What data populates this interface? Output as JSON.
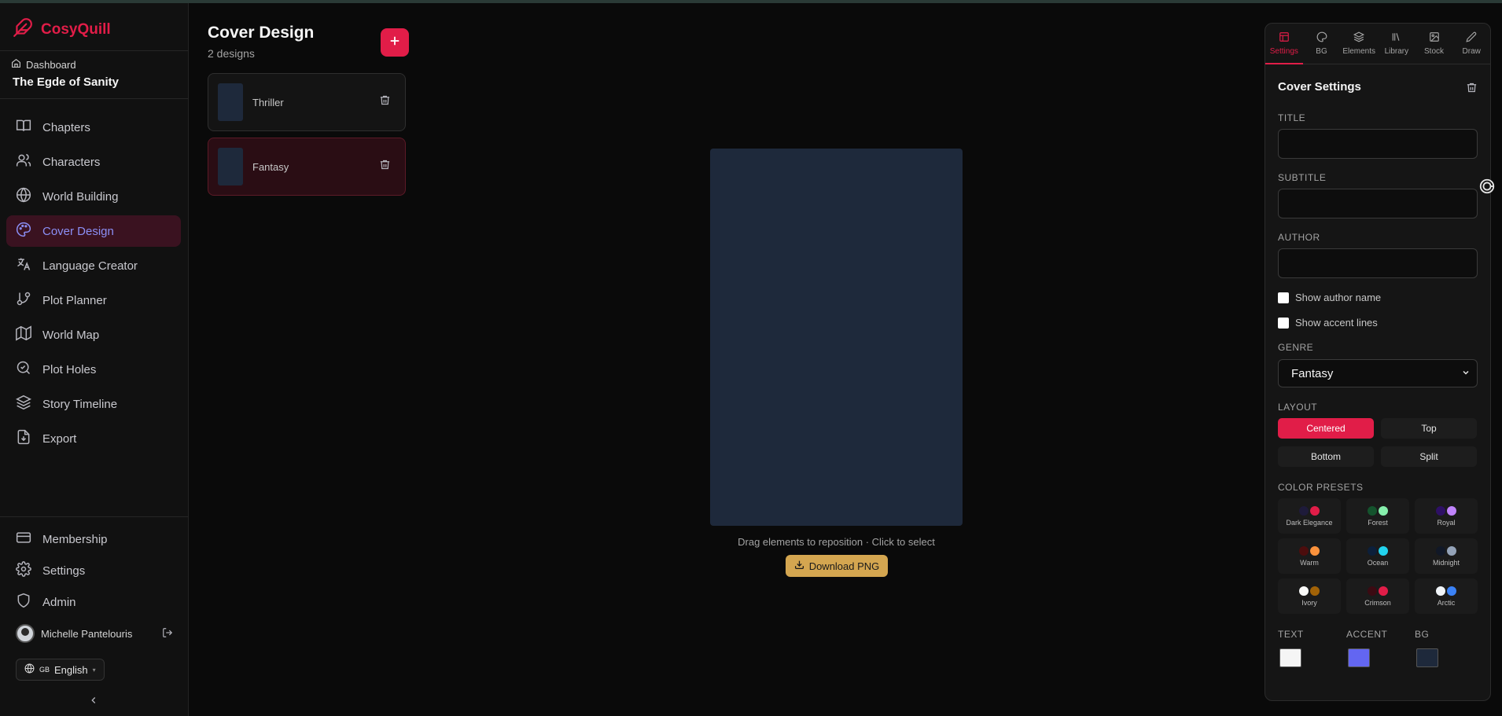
{
  "app": {
    "name": "CosyQuill"
  },
  "sidebar": {
    "dashboard_label": "Dashboard",
    "book_title": "The Egde of Sanity",
    "items": [
      {
        "label": "Chapters",
        "icon": "book-icon"
      },
      {
        "label": "Characters",
        "icon": "users-icon"
      },
      {
        "label": "World Building",
        "icon": "globe-icon"
      },
      {
        "label": "Cover Design",
        "icon": "palette-icon",
        "active": true
      },
      {
        "label": "Language Creator",
        "icon": "languages-icon"
      },
      {
        "label": "Plot Planner",
        "icon": "git-branch-icon"
      },
      {
        "label": "World Map",
        "icon": "map-icon"
      },
      {
        "label": "Plot Holes",
        "icon": "search-check-icon"
      },
      {
        "label": "Story Timeline",
        "icon": "layers-icon"
      },
      {
        "label": "Export",
        "icon": "file-export-icon"
      }
    ],
    "bottom_items": [
      {
        "label": "Membership",
        "icon": "credit-card-icon"
      },
      {
        "label": "Settings",
        "icon": "gear-icon"
      },
      {
        "label": "Admin",
        "icon": "shield-icon"
      }
    ],
    "user_name": "Michelle Pantelouris",
    "language_flag": "GB",
    "language": "English"
  },
  "designs": {
    "title": "Cover Design",
    "count_label": "2 designs",
    "add_label": "+",
    "list": [
      {
        "name": "Thriller"
      },
      {
        "name": "Fantasy",
        "active": true
      }
    ]
  },
  "canvas": {
    "bg_color": "#1e293b",
    "hint": "Drag elements to reposition · Click to select",
    "download_label": "Download PNG"
  },
  "panel": {
    "tabs": [
      {
        "label": "Settings",
        "icon": "layout-icon",
        "active": true
      },
      {
        "label": "BG",
        "icon": "palette-icon"
      },
      {
        "label": "Elements",
        "icon": "layers-icon"
      },
      {
        "label": "Library",
        "icon": "library-icon"
      },
      {
        "label": "Stock",
        "icon": "image-plus-icon"
      },
      {
        "label": "Draw",
        "icon": "pencil-icon"
      }
    ],
    "title": "Cover Settings",
    "title_label": "TITLE",
    "title_value": "",
    "subtitle_label": "SUBTITLE",
    "subtitle_value": "",
    "author_label": "AUTHOR",
    "author_value": "",
    "show_author_label": "Show author name",
    "show_accent_label": "Show accent lines",
    "genre_label": "GENRE",
    "genre_value": "Fantasy",
    "layout_label": "LAYOUT",
    "layouts": [
      {
        "label": "Centered",
        "active": true
      },
      {
        "label": "Top"
      },
      {
        "label": "Bottom"
      },
      {
        "label": "Split"
      }
    ],
    "presets_label": "COLOR PRESETS",
    "presets": [
      {
        "label": "Dark Elegance",
        "c1": "#1e1b3a",
        "c2": "#e11d48"
      },
      {
        "label": "Forest",
        "c1": "#14532d",
        "c2": "#86efac"
      },
      {
        "label": "Royal",
        "c1": "#2e1065",
        "c2": "#c084fc"
      },
      {
        "label": "Warm",
        "c1": "#4c0d0d",
        "c2": "#fb923c"
      },
      {
        "label": "Ocean",
        "c1": "#0c1f3a",
        "c2": "#22d3ee"
      },
      {
        "label": "Midnight",
        "c1": "#111827",
        "c2": "#94a3b8"
      },
      {
        "label": "Ivory",
        "c1": "#fafaf9",
        "c2": "#a16207"
      },
      {
        "label": "Crimson",
        "c1": "#3b0a12",
        "c2": "#e11d48"
      },
      {
        "label": "Arctic",
        "c1": "#f1f5f9",
        "c2": "#3b82f6"
      }
    ],
    "text_label": "TEXT",
    "accent_label": "ACCENT",
    "bg_label": "BG",
    "text_color": "#f5f5f5",
    "accent_color": "#6366f1",
    "bg_color": "#1e293b"
  }
}
